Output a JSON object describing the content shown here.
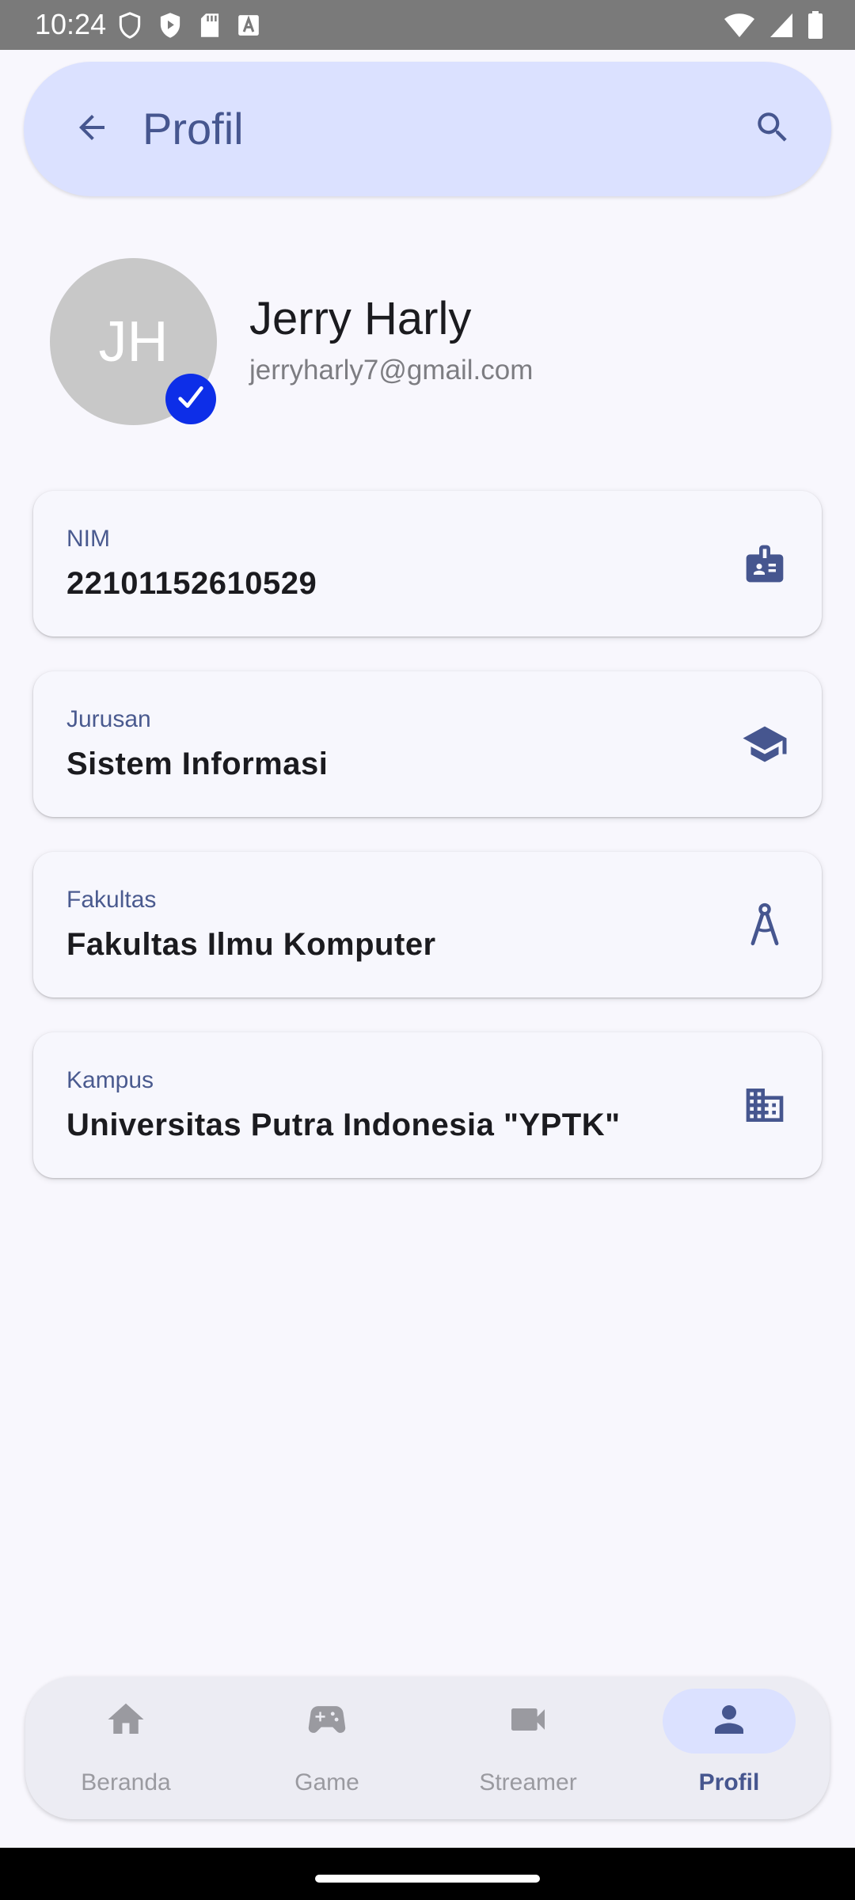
{
  "status_bar": {
    "time": "10:24",
    "left_icons": [
      "shield-icon",
      "play-protect-icon",
      "sd-card-icon",
      "text-icon"
    ],
    "right_icons": [
      "wifi-icon",
      "signal-icon",
      "battery-icon"
    ]
  },
  "top_bar": {
    "title": "Profil",
    "back_icon": "arrow-back-icon",
    "search_icon": "search-icon",
    "background": "#dbe1ff"
  },
  "profile": {
    "initials": "JH",
    "name": "Jerry Harly",
    "email": "jerryharly7@gmail.com",
    "verified_icon": "check-icon"
  },
  "cards": [
    {
      "label": "NIM",
      "value": "22101152610529",
      "icon": "badge-icon"
    },
    {
      "label": "Jurusan",
      "value": "Sistem Informasi",
      "icon": "graduation-cap-icon"
    },
    {
      "label": "Fakultas",
      "value": "Fakultas Ilmu Komputer",
      "icon": "compass-icon"
    },
    {
      "label": "Kampus",
      "value": "Universitas Putra Indonesia \"YPTK\"",
      "icon": "building-icon"
    }
  ],
  "bottom_nav": {
    "items": [
      {
        "label": "Beranda",
        "icon": "home-icon",
        "active": false
      },
      {
        "label": "Game",
        "icon": "gamepad-icon",
        "active": false
      },
      {
        "label": "Streamer",
        "icon": "videocam-icon",
        "active": false
      },
      {
        "label": "Profil",
        "icon": "person-icon",
        "active": true
      }
    ]
  },
  "colors": {
    "accent": "#46568f",
    "verified": "#0d2ee8",
    "page_background": "#f8f7fd"
  }
}
